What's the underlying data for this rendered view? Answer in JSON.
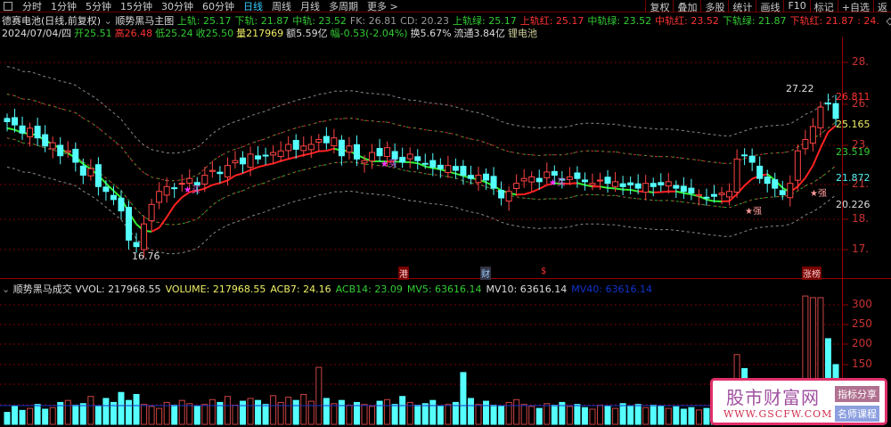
{
  "toolbar": {
    "periods": [
      "分时",
      "1分钟",
      "5分钟",
      "15分钟",
      "30分钟",
      "60分钟",
      "日线",
      "周线",
      "月线",
      "多周期",
      "更多 >"
    ],
    "active": "日线",
    "right": [
      "复权",
      "叠加",
      "多股",
      "统计",
      "画线",
      "F10",
      "标记",
      "+自选",
      "返"
    ]
  },
  "header": {
    "stock": "德赛电池(日线,前复权)",
    "indicator": "顺势黑马主图",
    "vals": [
      {
        "t": "上轨: 25.17",
        "c": "g"
      },
      {
        "t": "下轨: 21.87",
        "c": "g"
      },
      {
        "t": "中轨: 23.52",
        "c": "g"
      },
      {
        "t": "FK: 26.81",
        "c": "gr"
      },
      {
        "t": "CD: 20.23",
        "c": "gr"
      },
      {
        "t": "上轨绿: 25.17",
        "c": "g"
      },
      {
        "t": "上轨红: 25.17",
        "c": "r"
      },
      {
        "t": "中轨绿: 23.52",
        "c": "g"
      },
      {
        "t": "中轨红: 23.52",
        "c": "r"
      },
      {
        "t": "下轨绿: 21.87",
        "c": "g"
      },
      {
        "t": "下轨红: 21.87",
        "c": "r"
      },
      {
        "t": ": 24.",
        "c": "r"
      }
    ]
  },
  "quote": [
    {
      "t": "2024/07/04/四",
      "c": "w"
    },
    {
      "t": "开25.51",
      "c": "g"
    },
    {
      "t": "高26.48",
      "c": "r"
    },
    {
      "t": "低25.24",
      "c": "g"
    },
    {
      "t": "收25.50",
      "c": "g"
    },
    {
      "t": "量217969",
      "c": "yl"
    },
    {
      "t": "额5.59亿",
      "c": "w"
    },
    {
      "t": "幅-0.53(-2.04%)",
      "c": "g"
    },
    {
      "t": "换5.67%",
      "c": "w"
    },
    {
      "t": "流通3.84亿",
      "c": "w"
    },
    {
      "t": "锂电池",
      "c": "y"
    }
  ],
  "volume_header": {
    "indicator": "顺势黑马成交",
    "vals": [
      {
        "t": "VVOL: 217968.55",
        "c": "w"
      },
      {
        "t": "VOLUME: 217968.55",
        "c": "yl"
      },
      {
        "t": "ACB7: 24.16",
        "c": "yl"
      },
      {
        "t": "ACB14: 23.09",
        "c": "g"
      },
      {
        "t": "MV5: 63616.14",
        "c": "g"
      },
      {
        "t": "MV10: 63616.14",
        "c": "w"
      },
      {
        "t": "MV40: 63616.14",
        "c": "b"
      }
    ]
  },
  "price_axis": [
    "28.",
    "26.",
    "23.",
    "21.",
    "18.",
    "17."
  ],
  "volume_axis": [
    "300",
    "250",
    "200",
    "150"
  ],
  "price_labels": {
    "high": "27.22",
    "low": "16.76",
    "fk": "26.811",
    "upper": "25.165",
    "mid": "23.519",
    "lower": "21.872",
    "cd": "20.226"
  },
  "markers": {
    "gang": "港",
    "cai": "财",
    "dollar": "$",
    "zhangbang": "涨榜",
    "buy": "买",
    "strong": "强"
  },
  "watermark": {
    "name": "股市财富网",
    "url": "WWW.GSCFW.COM",
    "tag1": "指标分享",
    "tag2": "名师课程"
  },
  "chart_data": {
    "type": "candlestick",
    "closes": [
      25.3,
      25.1,
      24.6,
      24.9,
      24.3,
      23.8,
      24.0,
      23.2,
      23.5,
      22.8,
      22.0,
      22.4,
      21.3,
      21.0,
      20.5,
      19.8,
      18.0,
      17.6,
      19.0,
      20.2,
      21.0,
      21.3,
      21.2,
      21.5,
      21.8,
      21.4,
      22.0,
      22.3,
      22.1,
      22.6,
      22.9,
      22.7,
      23.3,
      23.0,
      23.2,
      23.4,
      23.5,
      23.9,
      23.6,
      23.8,
      23.9,
      24.2,
      24.0,
      24.3,
      23.2,
      23.8,
      23.0,
      22.9,
      23.4,
      23.2,
      23.7,
      23.0,
      22.8,
      23.3,
      22.9,
      22.7,
      22.5,
      22.4,
      22.6,
      22.3,
      22.0,
      21.8,
      22.0,
      21.7,
      21.2,
      20.6,
      21.0,
      21.5,
      21.8,
      21.9,
      21.6,
      22.2,
      22.0,
      21.7,
      21.9,
      21.8,
      21.6,
      21.5,
      21.7,
      21.5,
      21.6,
      21.3,
      21.4,
      21.2,
      21.5,
      21.3,
      21.4,
      21.6,
      21.2,
      21.0,
      20.9,
      20.8,
      20.6,
      20.7,
      20.9,
      21.0,
      23.0,
      23.2,
      22.8,
      21.8,
      21.5,
      21.2,
      20.8,
      21.5,
      23.5,
      24.2,
      25.0,
      26.2,
      26.4,
      25.5
    ],
    "volumes": [
      30,
      45,
      35,
      40,
      50,
      38,
      42,
      55,
      60,
      48,
      52,
      70,
      45,
      65,
      55,
      80,
      60,
      75,
      50,
      45,
      40,
      55,
      48,
      60,
      52,
      45,
      50,
      62,
      55,
      70,
      48,
      58,
      65,
      60,
      50,
      72,
      55,
      68,
      60,
      75,
      58,
      143,
      65,
      52,
      60,
      48,
      55,
      50,
      45,
      58,
      62,
      50,
      70,
      55,
      48,
      52,
      60,
      45,
      50,
      55,
      130,
      65,
      50,
      58,
      48,
      45,
      55,
      62,
      50,
      45,
      40,
      52,
      48,
      55,
      45,
      50,
      42,
      38,
      48,
      45,
      40,
      52,
      46,
      50,
      42,
      48,
      45,
      40,
      44,
      38,
      42,
      36,
      40,
      35,
      38,
      45,
      175,
      140,
      60,
      45,
      50,
      55,
      48,
      60,
      110,
      322,
      318,
      318,
      215,
      150
    ],
    "ylim": [
      16.5,
      28.5
    ],
    "vol_ylim": [
      0,
      330
    ]
  }
}
